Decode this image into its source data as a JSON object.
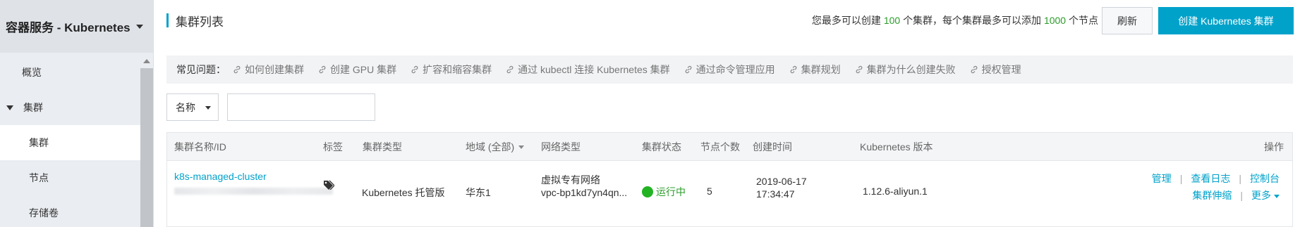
{
  "sidebar": {
    "header": "容器服务 - Kubernetes",
    "items": [
      {
        "label": "概览"
      },
      {
        "label": "集群"
      },
      {
        "label": "集群"
      },
      {
        "label": "节点"
      },
      {
        "label": "存储卷"
      }
    ]
  },
  "header": {
    "title": "集群列表",
    "limit": {
      "prefix": "您最多可以创建",
      "max_clusters": "100",
      "middle": "个集群，每个集群最多可以添加",
      "max_nodes": "1000",
      "suffix": "个节点"
    },
    "refresh_label": "刷新",
    "create_label": "创建 Kubernetes 集群"
  },
  "faq": {
    "label": "常见问题：",
    "links": [
      "如何创建集群",
      "创建 GPU 集群",
      "扩容和缩容集群",
      "通过 kubectl 连接 Kubernetes 集群",
      "通过命令管理应用",
      "集群规划",
      "集群为什么创建失败",
      "授权管理"
    ]
  },
  "search": {
    "field": "名称",
    "placeholder": ""
  },
  "table": {
    "columns": [
      "集群名称/ID",
      "标签",
      "集群类型",
      "地域 (全部)",
      "网络类型",
      "集群状态",
      "节点个数",
      "创建时间",
      "Kubernetes 版本",
      "操作"
    ],
    "rows": [
      {
        "name": "k8s-managed-cluster",
        "type": "Kubernetes 托管版",
        "region": "华东1",
        "network_type": "虚拟专有网络",
        "vpc": "vpc-bp1kd7yn4qn...",
        "status": "运行中",
        "nodes": "5",
        "created_date": "2019-06-17",
        "created_time": "17:34:47",
        "version": "1.12.6-aliyun.1",
        "actions": {
          "manage": "管理",
          "logs": "查看日志",
          "console": "控制台",
          "scale": "集群伸缩",
          "more": "更多"
        }
      }
    ]
  },
  "colors": {
    "accent": "#00a2ca",
    "status_running": "#22b322",
    "sidebar_bg": "#eaedf1"
  }
}
